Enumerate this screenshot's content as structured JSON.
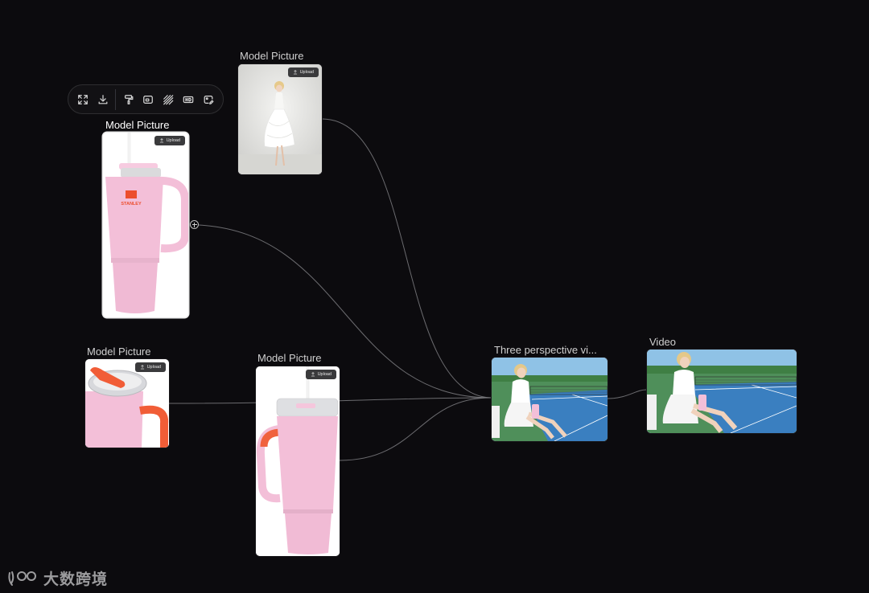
{
  "toolbar": {
    "buttons": [
      {
        "name": "expand-icon",
        "label": "Expand"
      },
      {
        "name": "download-icon",
        "label": "Download"
      },
      {
        "name": "paint-roller-icon",
        "label": "Paint"
      },
      {
        "name": "image-card-icon",
        "label": "Image"
      },
      {
        "name": "stripes-icon",
        "label": "Pattern"
      },
      {
        "name": "hd-icon",
        "label": "HD"
      },
      {
        "name": "image-edit-icon",
        "label": "Edit image"
      }
    ]
  },
  "nodes": {
    "model_top": {
      "title": "Model Picture",
      "upload_label": "Upload"
    },
    "model_left": {
      "title": "Model Picture",
      "upload_label": "Upload"
    },
    "model_bottom_left": {
      "title": "Model Picture",
      "upload_label": "Upload"
    },
    "model_bottom_center": {
      "title": "Model Picture",
      "upload_label": "Upload"
    },
    "three_perspective": {
      "title": "Three perspective vi..."
    },
    "video": {
      "title": "Video"
    }
  },
  "watermark": {
    "text": "大数跨境"
  },
  "colors": {
    "background": "#0c0b0e",
    "wire": "#7d7d80",
    "tumbler_pink": "#f3bfd8",
    "tumbler_orange": "#f0623e",
    "court_blue": "#3a7fc0",
    "court_green": "#4f8f5a"
  }
}
